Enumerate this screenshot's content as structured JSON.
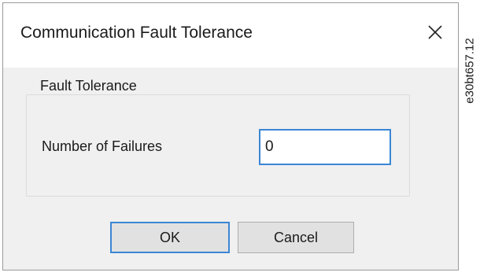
{
  "dialog": {
    "title": "Communication Fault Tolerance",
    "close_icon": "close-icon",
    "group": {
      "label": "Fault Tolerance",
      "field": {
        "label": "Number of Failures",
        "value": "0"
      }
    },
    "buttons": {
      "ok_label": "OK",
      "cancel_label": "Cancel"
    }
  },
  "figure_code": "e30bt657.12",
  "colors": {
    "focus_border": "#3a86d4",
    "dialog_background": "#f0f0f0",
    "button_face": "#e1e1e1"
  }
}
